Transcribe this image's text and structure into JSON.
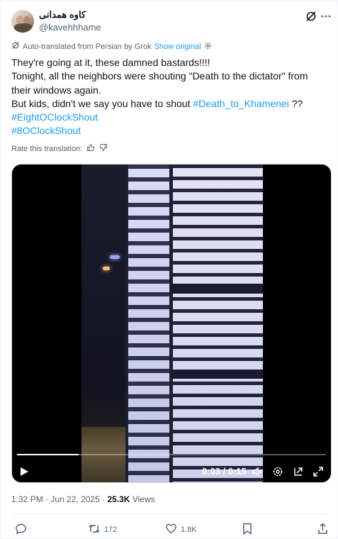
{
  "author": {
    "display_name": "کاوه همدانی",
    "handle": "@kavehhhame"
  },
  "translation": {
    "notice": "Auto-translated from Persian by Grok",
    "show_original": "Show original",
    "rate_label": "Rate this translation:"
  },
  "tweet": {
    "line1": "They're going at it, these damned bastards!!!!",
    "line2": "Tonight, all the neighbors were shouting \"Death to the dictator\" from",
    "line3": "their windows again.",
    "line4_prefix": "But kids, didn't we say you have to shout ",
    "line4_tag": "#Death_to_Khamenei",
    "line4_suffix": " ??",
    "tag2": "#EightOClockShout",
    "tag3": "#8OClockShout"
  },
  "video": {
    "time": "0:03 / 0:15",
    "progress": 0.2
  },
  "meta": {
    "time": "1:32 PM",
    "sep1": " · ",
    "date": "Jun 22, 2025",
    "sep2": " · ",
    "views_count": "25.3K",
    "views_label": " Views"
  },
  "actions": {
    "reposts": "172",
    "likes": "1.8K"
  },
  "colors": {
    "accent": "#1d9bf0",
    "muted": "#536471",
    "text": "#0f1419"
  }
}
